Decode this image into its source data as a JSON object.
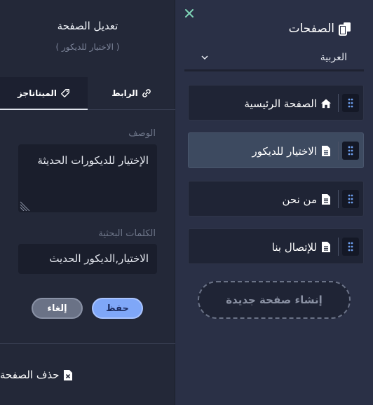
{
  "edit_panel": {
    "title": "تعديل الصفحة",
    "subtitle": "( الاختيار للديكور )",
    "tabs": [
      {
        "label": "الرابط",
        "icon": "link-icon",
        "active": false
      },
      {
        "label": "الميتاتاجز",
        "icon": "tag-icon",
        "active": true
      }
    ],
    "description_label": "الوصف",
    "description_value": "الإختيار للديكورات الحديثة",
    "keywords_label": "الكلمات البحثية",
    "keywords_value": "الاختيار,الديكور الحديث",
    "save_label": "حفظ",
    "cancel_label": "إلغاء",
    "delete_label": "حذف الصفحة"
  },
  "pages_panel": {
    "title": "الصفحات",
    "language": "العربية",
    "items": [
      {
        "label": "الصفحة الرئيسية",
        "icon": "home-icon",
        "selected": false
      },
      {
        "label": "الاختيار للديكور",
        "icon": "file-icon",
        "selected": true
      },
      {
        "label": "من نحن",
        "icon": "file-icon",
        "selected": false
      },
      {
        "label": "للإتصال بنا",
        "icon": "file-icon",
        "selected": false
      }
    ],
    "new_page_label": "إنشاء صفحة جديدة"
  },
  "colors": {
    "accent": "#7fa7f8",
    "close": "#7fd4b6",
    "handle_dots": "#6ea0f0"
  }
}
